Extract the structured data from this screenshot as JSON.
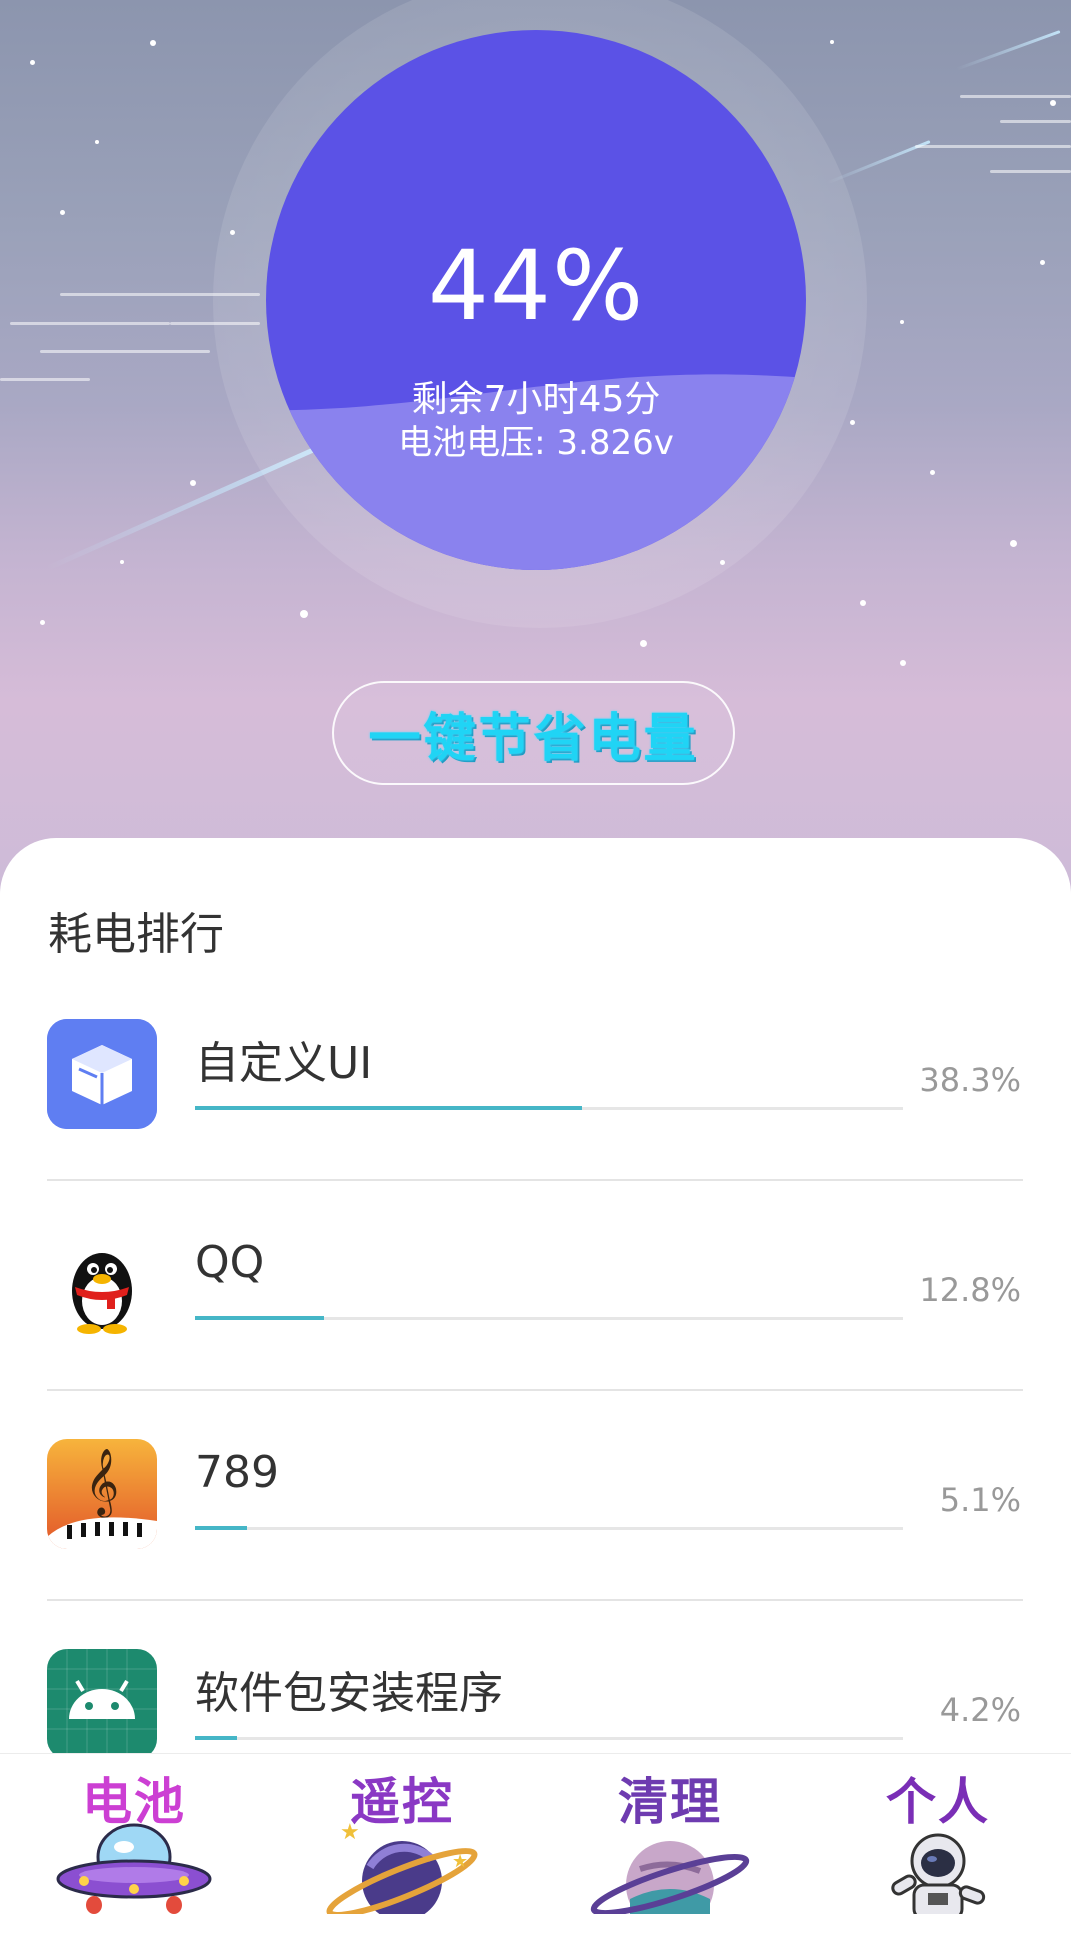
{
  "battery": {
    "percent": "44%",
    "percent_value": 44,
    "remaining": "剩余7小时45分",
    "voltage": "电池电压: 3.826v"
  },
  "save_button": {
    "label": "一键节省电量"
  },
  "ranking": {
    "title": "耗电排行",
    "items": [
      {
        "name": "自定义UI",
        "percent": "38.3%",
        "value": 38.3,
        "icon": "cube-app-icon"
      },
      {
        "name": "QQ",
        "percent": "12.8%",
        "value": 12.8,
        "icon": "qq-penguin-icon"
      },
      {
        "name": "789",
        "percent": "5.1%",
        "value": 5.1,
        "icon": "music-note-app-icon"
      },
      {
        "name": "软件包安装程序",
        "percent": "4.2%",
        "value": 4.2,
        "icon": "android-robot-icon"
      }
    ]
  },
  "nav": {
    "items": [
      {
        "label": "电池",
        "color": "#cc3fd3",
        "icon": "ufo-icon"
      },
      {
        "label": "遥控",
        "color": "#8a38c4",
        "icon": "planet-saturn-icon"
      },
      {
        "label": "清理",
        "color": "#6e3bb0",
        "icon": "planet-ring-icon"
      },
      {
        "label": "个人",
        "color": "#7a2eb6",
        "icon": "astronaut-icon"
      }
    ]
  },
  "colors": {
    "gauge_top": "#5b52e6",
    "gauge_bottom": "#8a82ee",
    "accent_bar": "#45b6c7",
    "save_text": "#20d4f5"
  }
}
